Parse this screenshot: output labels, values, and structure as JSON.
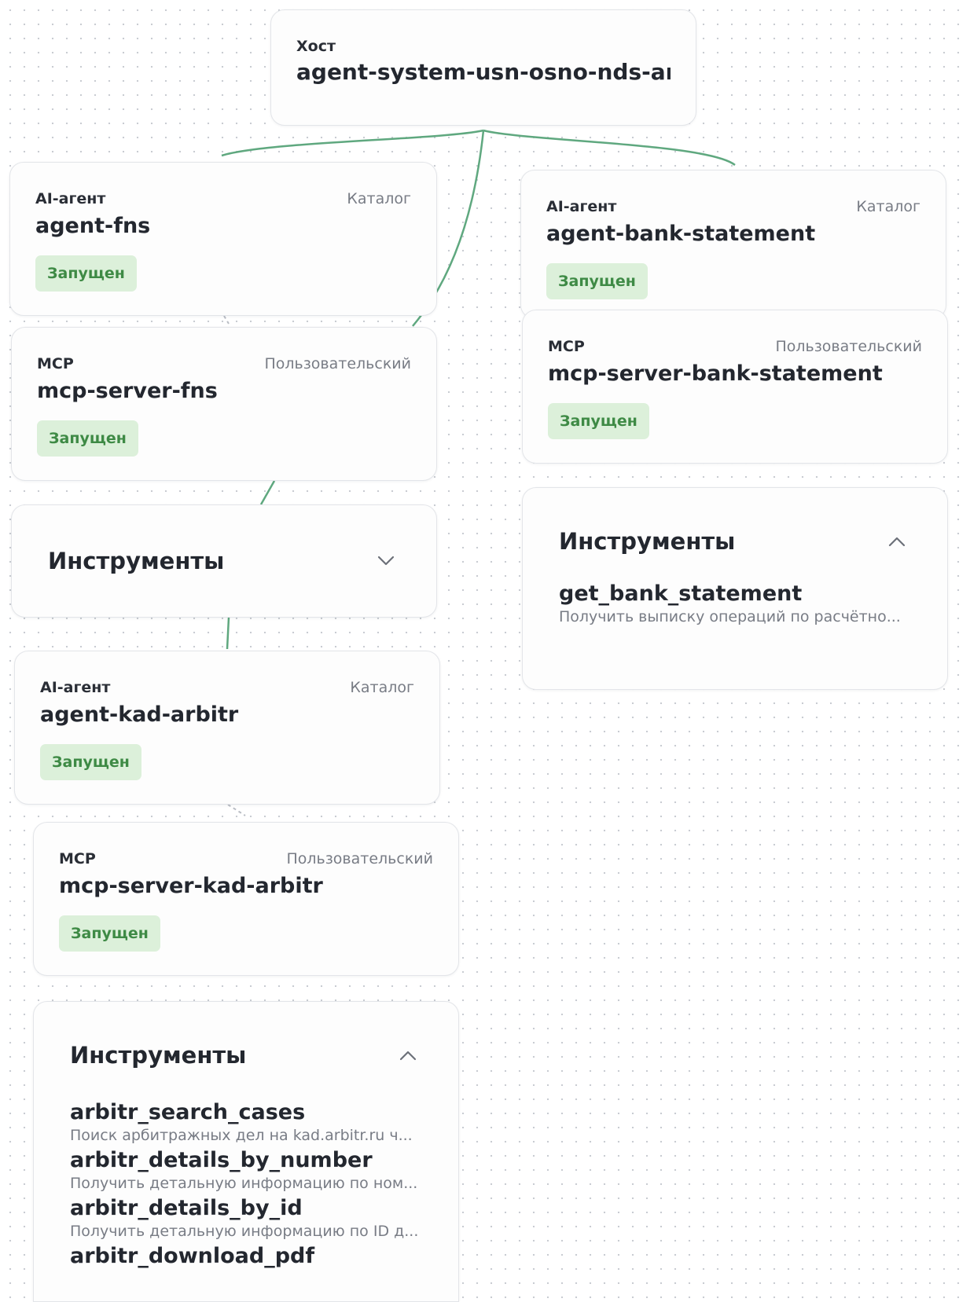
{
  "host": {
    "type": "Хост",
    "title": "agent-system-usn-osno-nds-and-ri..."
  },
  "agent_fns": {
    "type": "AI-агент",
    "tag": "Каталог",
    "title": "agent-fns",
    "status": "Запущен"
  },
  "agent_bank": {
    "type": "AI-агент",
    "tag": "Каталог",
    "title": "agent-bank-statement",
    "status": "Запущен"
  },
  "mcp_fns": {
    "type": "MCP",
    "tag": "Пользовательский",
    "title": "mcp-server-fns",
    "status": "Запущен"
  },
  "mcp_bank": {
    "type": "MCP",
    "tag": "Пользовательский",
    "title": "mcp-server-bank-statement",
    "status": "Запущен"
  },
  "tools_fns": {
    "title": "Инструменты",
    "expanded": false
  },
  "tools_bank": {
    "title": "Инструменты",
    "expanded": true,
    "items": [
      {
        "name": "get_bank_statement",
        "desc": "Получить выписку операций по расчётно..."
      }
    ]
  },
  "agent_kad": {
    "type": "AI-агент",
    "tag": "Каталог",
    "title": "agent-kad-arbitr",
    "status": "Запущен"
  },
  "mcp_kad": {
    "type": "MCP",
    "tag": "Пользовательский",
    "title": "mcp-server-kad-arbitr",
    "status": "Запущен"
  },
  "tools_kad": {
    "title": "Инструменты",
    "expanded": true,
    "items": [
      {
        "name": "arbitr_search_cases",
        "desc": "Поиск арбитражных дел на kad.arbitr.ru ч..."
      },
      {
        "name": "arbitr_details_by_number",
        "desc": "Получить детальную информацию по ном..."
      },
      {
        "name": "arbitr_details_by_id",
        "desc": "Получить детальную информацию по ID д..."
      },
      {
        "name": "arbitr_download_pdf",
        "desc": ""
      }
    ]
  },
  "colors": {
    "edge": "#5fa87f",
    "status_bg": "#dcf0da",
    "status_text": "#3e8a45"
  }
}
